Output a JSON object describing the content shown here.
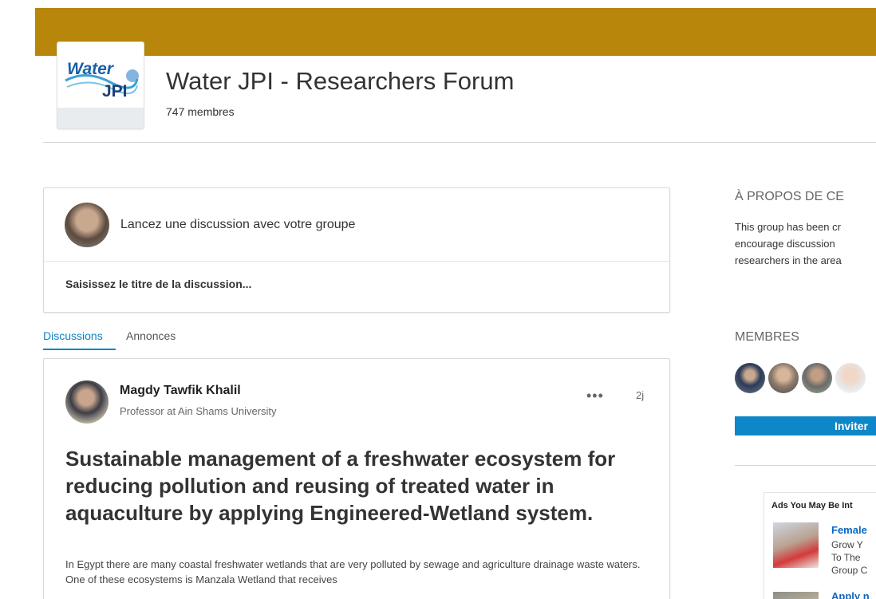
{
  "colors": {
    "banner": "#b8860b",
    "accent": "#0a84c6",
    "invite_button": "#0e87c8"
  },
  "group": {
    "logo_text_top": "Water",
    "logo_text_bottom": "JPI",
    "title": "Water JPI - Researchers Forum",
    "member_count": "747 membres"
  },
  "composer": {
    "prompt": "Lancez une discussion avec votre groupe",
    "title_placeholder": "Saisissez le titre de la discussion..."
  },
  "tabs": [
    {
      "label": "Discussions",
      "active": true
    },
    {
      "label": "Annonces",
      "active": false
    }
  ],
  "post": {
    "author_name": "Magdy Tawfik Khalil",
    "author_headline": "Professor at Ain Shams University",
    "menu_label": "•••",
    "age": "2j",
    "title": "Sustainable management of a freshwater ecosystem for reducing pollution and reusing of treated water in aquaculture by applying Engineered-Wetland system.",
    "body": "In Egypt there are many coastal freshwater wetlands that are very polluted by sewage and agriculture drainage waste waters. One of these ecosystems is Manzala Wetland that receives"
  },
  "sidebar": {
    "about_heading": "À PROPOS DE CE",
    "about_lines": [
      "This group has been cr",
      "encourage discussion",
      "researchers in the area"
    ],
    "members_heading": "MEMBRES",
    "invite_label": "Inviter"
  },
  "ads": {
    "title": "Ads You May Be Int",
    "ad1_head": "Female",
    "ad1_lines": [
      "Grow Y",
      "To The",
      "Group C"
    ],
    "ad2_head": "Apply n"
  }
}
